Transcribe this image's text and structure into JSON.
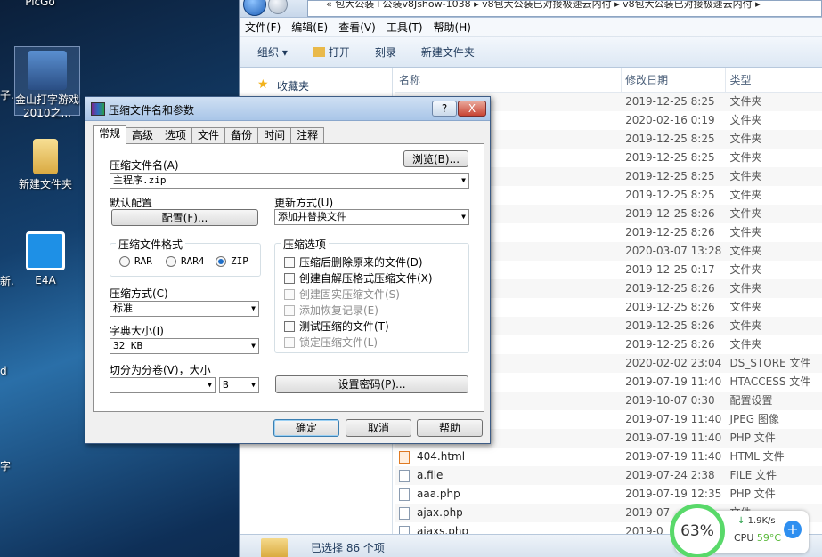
{
  "desktop": {
    "icons": [
      {
        "label": "PicGo",
        "id": "picgo"
      },
      {
        "label": "金山打字游戏2010之...",
        "id": "jinshan"
      },
      {
        "label": "新建文件夹",
        "id": "newfolder"
      },
      {
        "label": "E4A",
        "id": "e4a"
      }
    ],
    "fragments": [
      "子.",
      "新.",
      "d",
      "字"
    ]
  },
  "explorer": {
    "breadcrumbs": "« 包大公装+公装v8Jshow-1038 ▸ v8包大公装已对接极速云内付 ▸ v8包大公装已对接极速云内付 ▸",
    "menu": [
      "文件(F)",
      "编辑(E)",
      "查看(V)",
      "工具(T)",
      "帮助(H)"
    ],
    "toolbar": [
      "组织 ▾",
      "打开",
      "刻录",
      "新建文件夹"
    ],
    "nav_favorites": "收藏夹",
    "columns": {
      "name": "名称",
      "date": "修改日期",
      "type": "类型"
    },
    "rows": [
      {
        "name": "",
        "date": "2019-12-25 8:25",
        "type": "文件夹"
      },
      {
        "name": "",
        "date": "2020-02-16 0:19",
        "type": "文件夹"
      },
      {
        "name": "",
        "date": "2019-12-25 8:25",
        "type": "文件夹"
      },
      {
        "name": "",
        "date": "2019-12-25 8:25",
        "type": "文件夹"
      },
      {
        "name": "",
        "date": "2019-12-25 8:25",
        "type": "文件夹"
      },
      {
        "name": "",
        "date": "2019-12-25 8:25",
        "type": "文件夹"
      },
      {
        "name": "",
        "date": "2019-12-25 8:26",
        "type": "文件夹"
      },
      {
        "name": "",
        "date": "2019-12-25 8:26",
        "type": "文件夹"
      },
      {
        "name": "",
        "date": "2020-03-07 13:28",
        "type": "文件夹"
      },
      {
        "name": "",
        "date": "2019-12-25 0:17",
        "type": "文件夹"
      },
      {
        "name": "",
        "date": "2019-12-25 8:26",
        "type": "文件夹"
      },
      {
        "name": "",
        "date": "2019-12-25 8:26",
        "type": "文件夹"
      },
      {
        "name": "",
        "date": "2019-12-25 8:26",
        "type": "文件夹"
      },
      {
        "name": "",
        "date": "2019-12-25 8:26",
        "type": "文件夹"
      },
      {
        "name": "",
        "date": "2020-02-02 23:04",
        "type": "DS_STORE 文件"
      },
      {
        "name": "",
        "date": "2019-07-19 11:40",
        "type": "HTACCESS 文件"
      },
      {
        "name": "",
        "date": "2019-10-07 0:30",
        "type": "配置设置"
      },
      {
        "name": "",
        "date": "2019-07-19 11:40",
        "type": "JPEG 图像"
      },
      {
        "name": "",
        "date": "2019-07-19 11:40",
        "type": "PHP 文件"
      },
      {
        "name": "404.html",
        "date": "2019-07-19 11:40",
        "type": "HTML 文件"
      },
      {
        "name": "a.file",
        "date": "2019-07-24 2:38",
        "type": "FILE 文件"
      },
      {
        "name": "aaa.php",
        "date": "2019-07-19 12:35",
        "type": "PHP 文件"
      },
      {
        "name": "ajax.php",
        "date": "2019-07-",
        "type": "文件"
      },
      {
        "name": "ajaxs.php",
        "date": "2019-0",
        "type": ""
      }
    ],
    "status": "已选择 86 个项"
  },
  "widget": {
    "percent": "63%",
    "speed": "1.9K/s",
    "cpu_label": "CPU",
    "cpu_temp": "59°C",
    "plus": "+"
  },
  "dialog": {
    "title": "压缩文件名和参数",
    "help_btn": "?",
    "close_btn": "X",
    "tabs": [
      "常规",
      "高级",
      "选项",
      "文件",
      "备份",
      "时间",
      "注释"
    ],
    "archive_name_label": "压缩文件名(A)",
    "browse_btn": "浏览(B)...",
    "archive_name_value": "主程序.zip",
    "profile_label": "默认配置",
    "profile_btn": "配置(F)...",
    "update_label": "更新方式(U)",
    "update_value": "添加并替换文件",
    "format_label": "压缩文件格式",
    "formats": [
      {
        "label": "RAR",
        "on": false
      },
      {
        "label": "RAR4",
        "on": false
      },
      {
        "label": "ZIP",
        "on": true
      }
    ],
    "options_label": "压缩选项",
    "options": [
      {
        "label": "压缩后删除原来的文件(D)",
        "enabled": true
      },
      {
        "label": "创建自解压格式压缩文件(X)",
        "enabled": true
      },
      {
        "label": "创建固实压缩文件(S)",
        "enabled": false
      },
      {
        "label": "添加恢复记录(E)",
        "enabled": false
      },
      {
        "label": "测试压缩的文件(T)",
        "enabled": true
      },
      {
        "label": "锁定压缩文件(L)",
        "enabled": false
      }
    ],
    "method_label": "压缩方式(C)",
    "method_value": "标准",
    "dict_label": "字典大小(I)",
    "dict_value": "32 KB",
    "split_label": "切分为分卷(V)，大小",
    "split_value": "",
    "split_unit": "B",
    "password_btn": "设置密码(P)...",
    "ok_btn": "确定",
    "cancel_btn": "取消",
    "help_label": "帮助"
  }
}
